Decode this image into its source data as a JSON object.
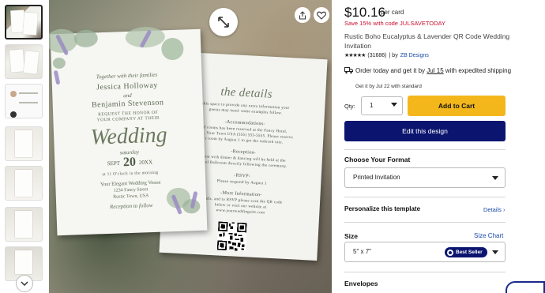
{
  "product": {
    "price": "$10.16",
    "price_unit": "per card",
    "promo": "Save 15% with code JULSAVETODAY",
    "title": "Rustic Boho Eucalyptus & Lavender QR Code Wedding Invitation",
    "stars": "★★★★★",
    "review_count": "(31686)",
    "by_prefix": "| by",
    "seller": "ZB Designs"
  },
  "shipping": {
    "prefix": "Order today and get it by",
    "date": "Jul 15",
    "suffix": "with expedited shipping",
    "standard": "Get it by Jul 22 with standard"
  },
  "purchase": {
    "qty_label": "Qty:",
    "qty_value": "1",
    "add_to_cart": "Add to Cart",
    "edit_design": "Edit this design"
  },
  "options": {
    "format_label": "Choose Your Format",
    "format_value": "Printed Invitation",
    "personalize_label": "Personalize this template",
    "details_link": "Details",
    "size_label": "Size",
    "size_chart_link": "Size Chart",
    "size_value": "5\" x 7\"",
    "best_seller": "Best Seller",
    "envelopes_label": "Envelopes"
  },
  "invitation_front": {
    "together": "Together with their families",
    "name1": "Jessica Holloway",
    "and": "and",
    "name2": "Benjamin Stevenson",
    "request1": "request the honor of",
    "request2": "your company at their",
    "wedding": "Wedding",
    "day": "saturday",
    "month": "SEPT",
    "date_num": "20",
    "year": "20XX",
    "time": "at 11 O'clock in the morning",
    "venue": "Your Elegant Wedding Venue",
    "street": "1234 Fancy Street",
    "city": "Rustic Town, USA",
    "reception": "Reception to follow"
  },
  "invitation_back": {
    "heading": "the details",
    "intro1": "this space to provide any extra information your",
    "intro2": "guests may need. some examples follow.",
    "accom_h": "-Accommodations-",
    "accom1": "of rooms has been reserved at the Fancy Hotel,",
    "accom2": "n St., Your Town USA (555) 555-5555. Please reserve",
    "accom3": "r room by August 1 to get the reduced rate.",
    "recep_h": "-Reception-",
    "recep1": "ption with dinner & dancing will be held at the",
    "recep2": "Hotel Ballroom directly following the ceremony.",
    "rsvp_h": "-RSVP-",
    "rsvp1": "Please respond by August 1",
    "more_h": "-More Information-",
    "more1": "details, and to RSVP please scan the QR code",
    "more2": "below or visit our website at",
    "more3": "www.yourweddingsite.com"
  },
  "icons": {
    "expand": "expand-icon",
    "share": "share-icon",
    "favorite": "heart-icon",
    "truck": "truck-icon",
    "scroll_down": "chevron-down-icon"
  },
  "colors": {
    "promo_red": "#c8102e",
    "cart_yellow": "#f3b71c",
    "navy": "#0b1570",
    "link_blue": "#1a4aa8"
  }
}
